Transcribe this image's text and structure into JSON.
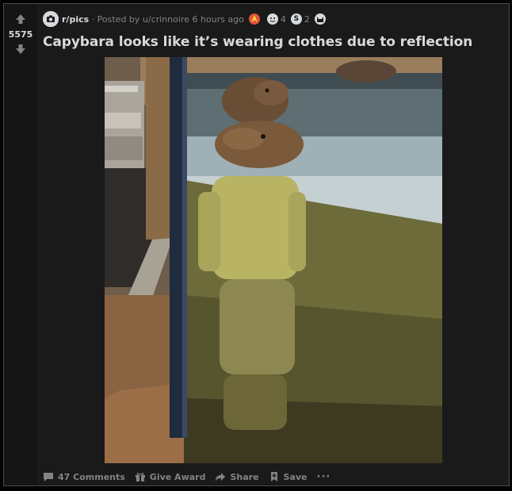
{
  "post": {
    "score": "5575",
    "subreddit": "r/pics",
    "separator": "·",
    "posted_by": "Posted by u/crinnoire 6 hours ago",
    "awards": [
      {
        "icon": "rocket-award-icon",
        "count": ""
      },
      {
        "icon": "wholesome-award-icon",
        "count": "4"
      },
      {
        "icon": "silver-award-icon",
        "count": "2"
      },
      {
        "icon": "cat-award-icon",
        "count": ""
      }
    ],
    "title": "Capybara looks like it’s wearing clothes due to reflection"
  },
  "actions": {
    "comments": "47 Comments",
    "give_award": "Give Award",
    "share": "Share",
    "save": "Save",
    "more": "···"
  },
  "colors": {
    "background": "#1a1a1b",
    "border": "#4a4a4c",
    "text_primary": "#d7dadc",
    "text_muted": "#818384"
  }
}
